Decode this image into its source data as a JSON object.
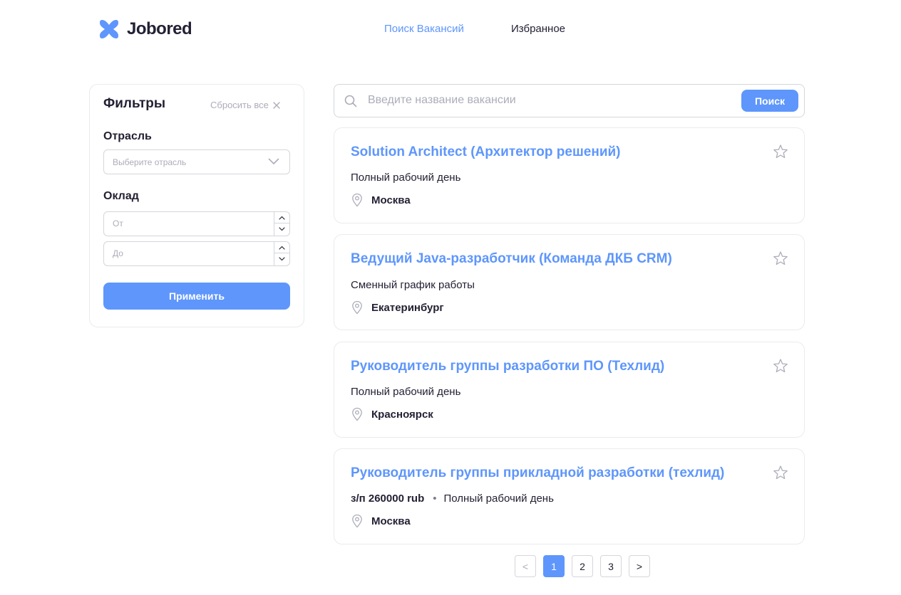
{
  "header": {
    "logo_text": "Jobored",
    "nav": [
      {
        "label": "Поиск Вакансий",
        "active": true
      },
      {
        "label": "Избранное",
        "active": false
      }
    ]
  },
  "filters": {
    "title": "Фильтры",
    "reset_label": "Сбросить все",
    "industry_label": "Отрасль",
    "industry_placeholder": "Выберите отрасль",
    "salary_label": "Оклад",
    "salary_from_placeholder": "От",
    "salary_to_placeholder": "До",
    "apply_label": "Применить"
  },
  "search": {
    "placeholder": "Введите название вакансии",
    "button_label": "Поиск"
  },
  "vacancies": [
    {
      "title": "Solution Architect (Архитектор решений)",
      "salary": "",
      "schedule": "Полный рабочий день",
      "location": "Москва"
    },
    {
      "title": "Ведущий Java-разработчик (Команда ДКБ CRM)",
      "salary": "",
      "schedule": "Сменный график работы",
      "location": "Екатеринбург"
    },
    {
      "title": "Руководитель группы разработки ПО (Техлид)",
      "salary": "",
      "schedule": "Полный рабочий день",
      "location": "Красноярск"
    },
    {
      "title": "Руководитель группы прикладной разработки (техлид)",
      "salary": "з/п 260000 rub",
      "separator": "•",
      "schedule": "Полный рабочий день",
      "location": "Москва"
    }
  ],
  "pagination": {
    "prev": "<",
    "pages": [
      "1",
      "2",
      "3"
    ],
    "current": "1",
    "next": ">"
  },
  "colors": {
    "accent": "#5e96fc",
    "text": "#232134",
    "muted": "#acadb9",
    "border": "#eaebed"
  }
}
